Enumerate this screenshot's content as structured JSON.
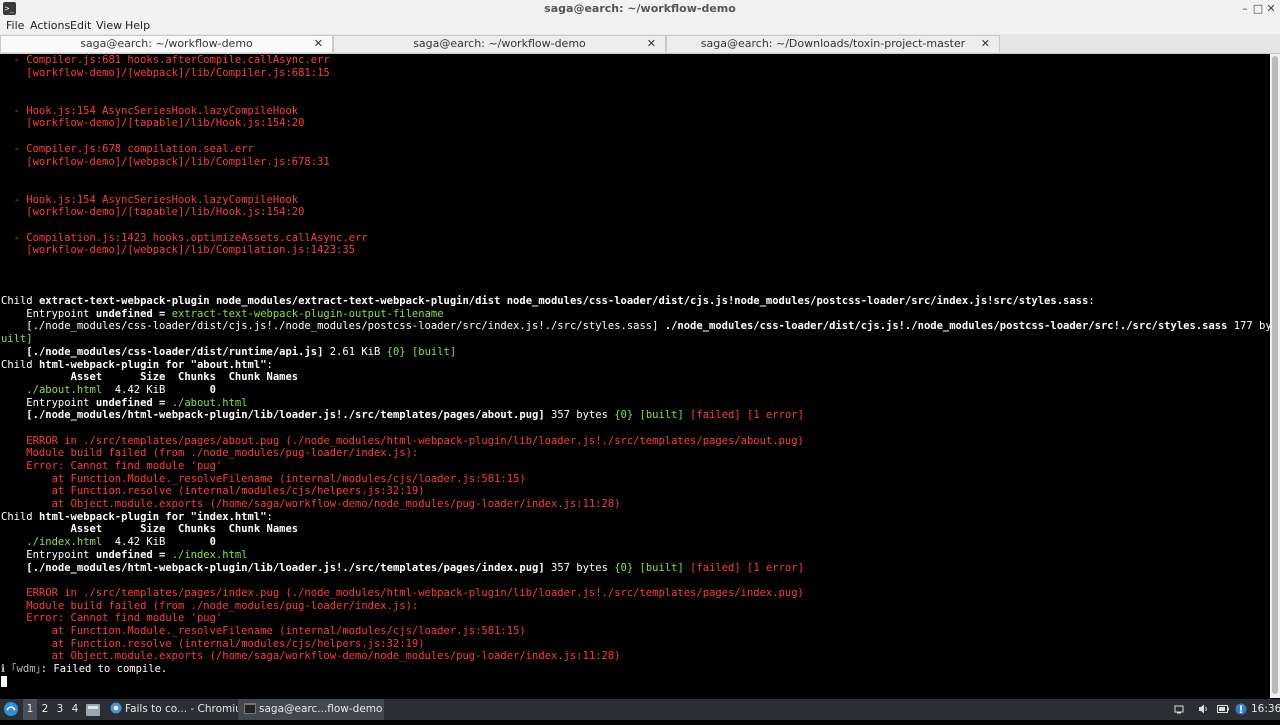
{
  "window": {
    "title": "saga@earch: ~/workflow-demo",
    "app_icon": "terminal-icon",
    "controls": {
      "minimize": "–",
      "maximize": "□",
      "close": "✕"
    }
  },
  "menu": {
    "items": [
      "File",
      "Actions",
      "Edit",
      "View",
      "Help"
    ]
  },
  "tabs": [
    {
      "label": "saga@earch: ~/workflow-demo",
      "active": true
    },
    {
      "label": "saga@earch: ~/workflow-demo",
      "active": false
    },
    {
      "label": "saga@earch: ~/Downloads/toxin-project-master",
      "active": false
    }
  ],
  "tab_close_glyph": "✕",
  "terminal": {
    "lines": [
      [
        [
          "r",
          "  - Compiler.js:681 hooks.afterCompile.callAsync.err"
        ]
      ],
      [
        [
          "r",
          "    [workflow-demo]/[webpack]/lib/Compiler.js:681:15"
        ]
      ],
      [],
      [],
      [
        [
          "r",
          "  - Hook.js:154 AsyncSeriesHook.lazyCompileHook"
        ]
      ],
      [
        [
          "r",
          "    [workflow-demo]/[tapable]/lib/Hook.js:154:20"
        ]
      ],
      [],
      [
        [
          "r",
          "  - Compiler.js:678 compilation.seal.err"
        ]
      ],
      [
        [
          "r",
          "    [workflow-demo]/[webpack]/lib/Compiler.js:678:31"
        ]
      ],
      [],
      [],
      [
        [
          "r",
          "  - Hook.js:154 AsyncSeriesHook.lazyCompileHook"
        ]
      ],
      [
        [
          "r",
          "    [workflow-demo]/[tapable]/lib/Hook.js:154:20"
        ]
      ],
      [],
      [
        [
          "r",
          "  - Compilation.js:1423 hooks.optimizeAssets.callAsync.err"
        ]
      ],
      [
        [
          "r",
          "    [workflow-demo]/[webpack]/lib/Compilation.js:1423:35"
        ]
      ],
      [],
      [],
      [],
      [
        [
          "",
          "Child "
        ],
        [
          "b",
          "extract-text-webpack-plugin node_modules/extract-text-webpack-plugin/dist node_modules/css-loader/dist/cjs.js!node_modules/postcss-loader/src/index.js!src/styles.sass"
        ],
        [
          "",
          ":"
        ]
      ],
      [
        [
          "",
          "    Entrypoint "
        ],
        [
          "b",
          "undefined"
        ],
        [
          "b",
          " = "
        ],
        [
          "g",
          "extract-text-webpack-plugin-output-filename"
        ]
      ],
      [
        [
          "",
          "    [./node_modules/css-loader/dist/cjs.js!./node_modules/postcss-loader/src/index.js!./src/styles.sass] "
        ],
        [
          "b",
          "./node_modules/css-loader/dist/cjs.js!./node_modules/postcss-loader/src!./src/styles.sass"
        ],
        [
          "",
          " 177 bytes "
        ],
        [
          "g",
          "{0}"
        ],
        [
          "",
          " "
        ],
        [
          "g",
          "[b"
        ]
      ],
      [
        [
          "g",
          "uilt]"
        ]
      ],
      [
        [
          "",
          "    "
        ],
        [
          "b",
          "[./node_modules/css-loader/dist/runtime/api.js]"
        ],
        [
          "",
          " 2.61 KiB "
        ],
        [
          "g",
          "{0}"
        ],
        [
          "",
          " "
        ],
        [
          "g",
          "[built]"
        ]
      ],
      [
        [
          "",
          "Child "
        ],
        [
          "b",
          "html-webpack-plugin for \"about.html\""
        ],
        [
          "",
          ":"
        ]
      ],
      [
        [
          "b",
          "           Asset      Size  Chunks  Chunk Names"
        ]
      ],
      [
        [
          "",
          "    "
        ],
        [
          "g",
          "./about.html"
        ],
        [
          "",
          "  4.42 KiB       "
        ],
        [
          "b",
          "0"
        ]
      ],
      [
        [
          "",
          "    Entrypoint "
        ],
        [
          "b",
          "undefined"
        ],
        [
          "b",
          " = "
        ],
        [
          "g",
          "./about.html"
        ]
      ],
      [
        [
          "",
          "    "
        ],
        [
          "b",
          "[./node_modules/html-webpack-plugin/lib/loader.js!./src/templates/pages/about.pug]"
        ],
        [
          "",
          " 357 bytes "
        ],
        [
          "g",
          "{0}"
        ],
        [
          "",
          " "
        ],
        [
          "g",
          "[built]"
        ],
        [
          "",
          " "
        ],
        [
          "r",
          "[failed]"
        ],
        [
          "",
          " "
        ],
        [
          "r",
          "[1 error]"
        ]
      ],
      [],
      [
        [
          "r",
          "    ERROR in ./src/templates/pages/about.pug (./node_modules/html-webpack-plugin/lib/loader.js!./src/templates/pages/about.pug)"
        ]
      ],
      [
        [
          "r",
          "    Module build failed (from ./node_modules/pug-loader/index.js):"
        ]
      ],
      [
        [
          "r",
          "    Error: Cannot find module 'pug'"
        ]
      ],
      [
        [
          "r",
          "        at Function.Module._resolveFilename (internal/modules/cjs/loader.js:581:15)"
        ]
      ],
      [
        [
          "r",
          "        at Function.resolve (internal/modules/cjs/helpers.js:32:19)"
        ]
      ],
      [
        [
          "r",
          "        at Object.module.exports (/home/saga/workflow-demo/node_modules/pug-loader/index.js:11:28)"
        ]
      ],
      [
        [
          "",
          "Child "
        ],
        [
          "b",
          "html-webpack-plugin for \"index.html\""
        ],
        [
          "",
          ":"
        ]
      ],
      [
        [
          "b",
          "           Asset      Size  Chunks  Chunk Names"
        ]
      ],
      [
        [
          "",
          "    "
        ],
        [
          "g",
          "./index.html"
        ],
        [
          "",
          "  4.42 KiB       "
        ],
        [
          "b",
          "0"
        ]
      ],
      [
        [
          "",
          "    Entrypoint "
        ],
        [
          "b",
          "undefined"
        ],
        [
          "b",
          " = "
        ],
        [
          "g",
          "./index.html"
        ]
      ],
      [
        [
          "",
          "    "
        ],
        [
          "b",
          "[./node_modules/html-webpack-plugin/lib/loader.js!./src/templates/pages/index.pug]"
        ],
        [
          "",
          " 357 bytes "
        ],
        [
          "g",
          "{0}"
        ],
        [
          "",
          " "
        ],
        [
          "g",
          "[built]"
        ],
        [
          "",
          " "
        ],
        [
          "r",
          "[failed]"
        ],
        [
          "",
          " "
        ],
        [
          "r",
          "[1 error]"
        ]
      ],
      [],
      [
        [
          "r",
          "    ERROR in ./src/templates/pages/index.pug (./node_modules/html-webpack-plugin/lib/loader.js!./src/templates/pages/index.pug)"
        ]
      ],
      [
        [
          "r",
          "    Module build failed (from ./node_modules/pug-loader/index.js):"
        ]
      ],
      [
        [
          "r",
          "    Error: Cannot find module 'pug'"
        ]
      ],
      [
        [
          "r",
          "        at Function.Module._resolveFilename (internal/modules/cjs/loader.js:581:15)"
        ]
      ],
      [
        [
          "r",
          "        at Function.resolve (internal/modules/cjs/helpers.js:32:19)"
        ]
      ],
      [
        [
          "r",
          "        at Object.module.exports (/home/saga/workflow-demo/node_modules/pug-loader/index.js:11:28)"
        ]
      ],
      [
        [
          "dim",
          "ℹ ｢wdm｣"
        ],
        [
          "",
          ": Failed to compile."
        ]
      ]
    ]
  },
  "taskbar": {
    "start_icon": "start-menu-icon",
    "workspaces": [
      "1",
      "2",
      "3",
      "4"
    ],
    "active_workspace": "1",
    "tasks": [
      {
        "label": "Fails to co... - Chromium",
        "icon": "chromium-icon",
        "active": false
      },
      {
        "label": "saga@earc...flow-demo",
        "icon": "terminal-icon",
        "active": true
      }
    ],
    "tray": {
      "icons": [
        "network-icon",
        "volume-icon",
        "power-icon",
        "update-icon"
      ],
      "clock": "16:36"
    }
  }
}
